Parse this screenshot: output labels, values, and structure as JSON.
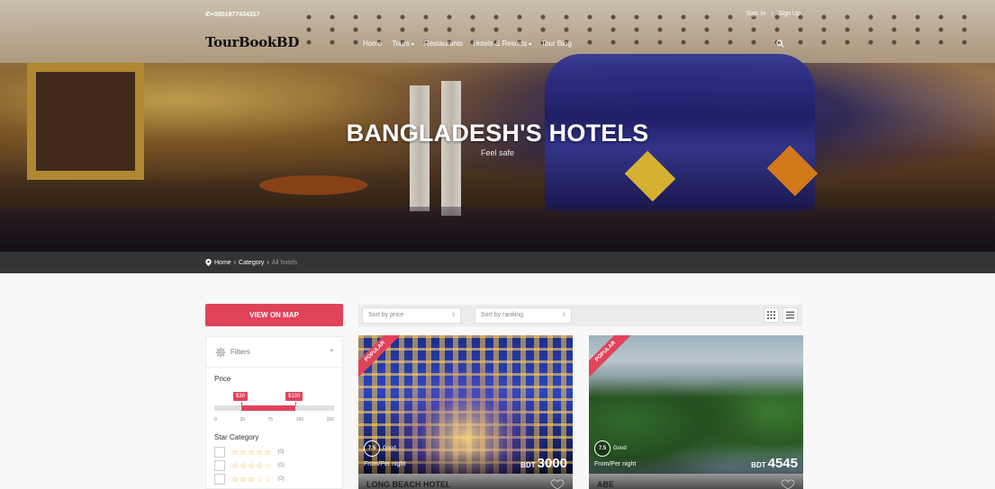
{
  "topbar": {
    "phone": "+8801977434317",
    "sign_in": "Sign In",
    "separator": "|",
    "sign_up": "Sign Up"
  },
  "header": {
    "logo": "TourBookBD",
    "nav": [
      {
        "label": "Home"
      },
      {
        "label": "Tours",
        "caret": "▾"
      },
      {
        "label": "Restaurants"
      },
      {
        "label": "Hotels & Resorts",
        "caret": "▾"
      },
      {
        "label": "Tour Blog"
      }
    ]
  },
  "hero": {
    "title": "BANGLADESH'S HOTELS",
    "subtitle": "Feel safe"
  },
  "breadcrumb": {
    "items": [
      "Home",
      "Category",
      "All hotels"
    ],
    "separator": "›"
  },
  "sidebar": {
    "map_button": "VIEW ON MAP",
    "filters_label": "Filters",
    "filters_toggle": "+",
    "price_label": "Price",
    "price_min_tag": "$30",
    "price_max_tag": "$100",
    "price_min_fraction": 0.3,
    "price_max_fraction": 0.7,
    "price_ticks": [
      "0",
      "30",
      "75",
      "100",
      "150"
    ],
    "star_category_label": "Star Category",
    "star_rows": [
      {
        "stars": "☆☆☆☆☆",
        "count": "(0)"
      },
      {
        "stars": "☆☆☆☆",
        "empty": "☆",
        "count": "(0)"
      },
      {
        "stars": "☆☆☆",
        "empty": "☆☆",
        "count": "(0)"
      }
    ]
  },
  "toolbar": {
    "sort_price": "Sort by price",
    "sort_ranking": "Sort by ranking",
    "sort_arrow": "⇕"
  },
  "cards": [
    {
      "ribbon": "POPULAR",
      "score": "7.5",
      "score_label": "Good",
      "per_night": "From/Per night",
      "currency": "BDT",
      "price": "3000",
      "name": "LONG BEACH HOTEL"
    },
    {
      "ribbon": "POPULAR",
      "score": "7.5",
      "score_label": "Good",
      "per_night": "From/Per night",
      "currency": "BDT",
      "price": "4545",
      "name": "ABE"
    }
  ],
  "colors": {
    "accent": "#e0435a",
    "breadcrumb_bar": "#333436",
    "star": "#f4a91b"
  },
  "icons": [
    "phone-icon",
    "search-icon",
    "map-pin-icon",
    "gear-icon",
    "grid-view-icon",
    "list-view-icon",
    "heart-icon"
  ]
}
